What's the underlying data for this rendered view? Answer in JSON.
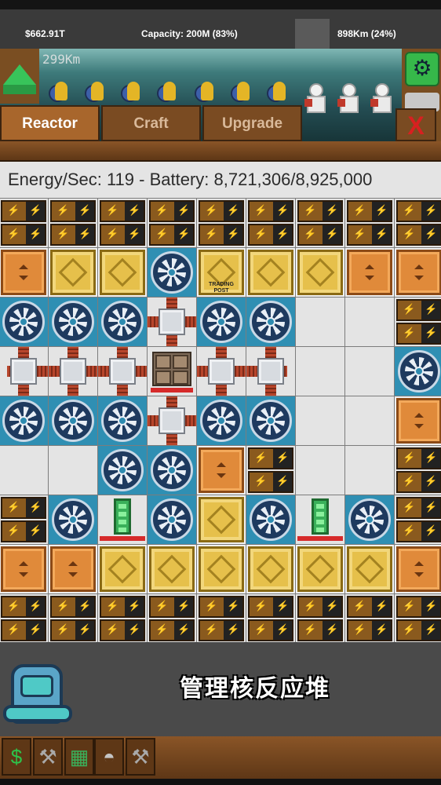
{
  "status": {
    "money": "$662.91T",
    "capacity": "Capacity: 200M (83%)",
    "depth": "898Km (24%)"
  },
  "scene": {
    "depth_label": "299Km"
  },
  "tabs": {
    "reactor": "Reactor",
    "craft": "Craft",
    "upgrade": "Upgrade",
    "close": "X",
    "active": "reactor"
  },
  "info": {
    "text": "Energy/Sec: 119 - Battery: 8,721,306/8,925,000"
  },
  "grid": {
    "rows": [
      [
        "battery",
        "battery",
        "battery",
        "battery",
        "battery",
        "battery",
        "battery",
        "battery",
        "battery"
      ],
      [
        "vent",
        "plating",
        "plating",
        "fan",
        "plating",
        "plating",
        "plating",
        "vent",
        "vent"
      ],
      [
        "fan",
        "fan",
        "fan",
        "pipe-cross",
        "fan",
        "fan",
        "empty",
        "empty",
        "battery"
      ],
      [
        "pipe-h-left",
        "pipe-h",
        "pipe-h",
        "core",
        "pipe-h",
        "pipe-h-right",
        "empty",
        "empty",
        "fan"
      ],
      [
        "fan",
        "fan",
        "fan",
        "pipe-cross",
        "fan",
        "fan",
        "empty",
        "empty",
        "vent"
      ],
      [
        "empty",
        "empty",
        "fan",
        "fan",
        "vent",
        "battery",
        "empty",
        "empty",
        "battery"
      ],
      [
        "battery",
        "fan",
        "rod",
        "fan",
        "plating",
        "fan",
        "rod",
        "fan",
        "battery"
      ],
      [
        "vent",
        "vent",
        "plating",
        "plating",
        "plating",
        "plating",
        "plating",
        "plating",
        "vent"
      ],
      [
        "battery",
        "battery",
        "battery",
        "battery",
        "battery",
        "battery",
        "battery",
        "battery",
        "battery"
      ]
    ],
    "trading_post_label": "TRADING POST"
  },
  "bottom": {
    "caption": "管理核反应堆",
    "tools": [
      "money-icon",
      "anvil-icon",
      "craft-icon",
      "cave-icon",
      "anvil-icon"
    ],
    "money_glyph": "$"
  },
  "colors": {
    "accent_green": "#38c45a",
    "wood": "#7a4b22",
    "close_red": "#d82020"
  }
}
